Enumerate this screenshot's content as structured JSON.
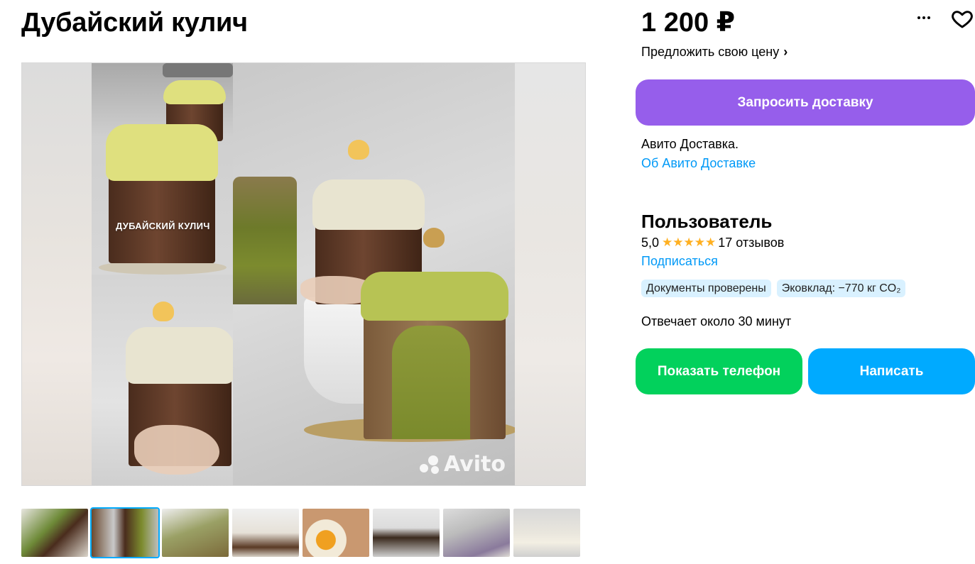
{
  "listing": {
    "title": "Дубайский кулич",
    "photo_overlay_label": "ДУБАЙСКИЙ КУЛИЧ",
    "watermark": "Avito",
    "thumbnails_count": 8,
    "active_thumbnail_index": 1
  },
  "price": {
    "value": "1 200 ₽",
    "offer_label": "Предложить свою цену",
    "offer_chevron": "›"
  },
  "actions": {
    "more_icon": "more-horizontal-icon",
    "favorite_icon": "heart-icon",
    "delivery_button": "Запросить доставку",
    "show_phone_button": "Показать телефон",
    "write_button": "Написать"
  },
  "delivery": {
    "text": "Авито Доставка.",
    "link": "Об Авито Доставке"
  },
  "seller": {
    "name": "Пользователь",
    "rating": "5,0",
    "stars": 5,
    "reviews": "17 отзывов",
    "subscribe": "Подписаться",
    "badges": [
      "Документы проверены",
      "Эковклад: −770 кг CO₂"
    ],
    "reply_time": "Отвечает около 30 минут"
  },
  "colors": {
    "delivery_button": "#965eeb",
    "phone_button": "#02d15c",
    "write_button": "#00aaff",
    "link": "#0099f7",
    "star": "#ffb021",
    "badge_bg": "#d9f1ff"
  }
}
